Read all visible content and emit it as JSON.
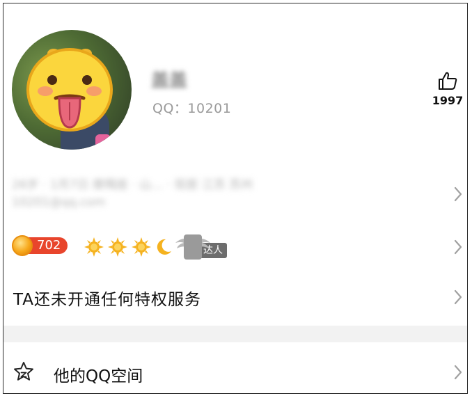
{
  "profile": {
    "nickname": "盖盖",
    "qq_label": "QQ：10201",
    "likes": "1997"
  },
  "info": {
    "line1": "26岁 · 1月7日 摩羯座 · 山… · 现居 江苏 苏州",
    "line2": "10201@qq.com"
  },
  "level": {
    "number": "702",
    "suns": 3,
    "moons": 1,
    "daren_label": "达人"
  },
  "privilege": {
    "label": "TA还未开通任何特权服务"
  },
  "qzone": {
    "label": "他的QQ空间"
  },
  "colors": {
    "level_red": "#e8452c",
    "level_coin": "#f7a81b",
    "sun": "#f5b21f",
    "chevron": "#a0a0a0"
  }
}
